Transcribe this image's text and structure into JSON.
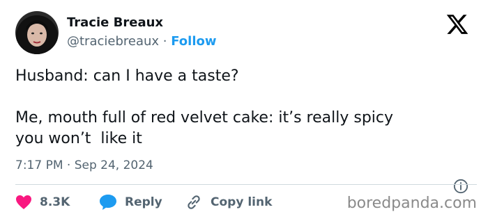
{
  "tweet": {
    "author_name": "Tracie Breaux",
    "handle": "@traciebreaux",
    "separator": " · ",
    "follow_label": "Follow",
    "text_lines": [
      "Husband: can I have a taste?",
      "",
      "Me, mouth full of red velvet cake: it’s really spicy",
      "you won’t  like it"
    ],
    "timestamp": "7:17 PM · Sep 24, 2024"
  },
  "actions": {
    "like_count": "8.3K",
    "reply_label": "Reply",
    "copy_link_label": "Copy link"
  },
  "watermark": "boredpanda.com",
  "icons": [
    "x-logo-icon",
    "info-icon",
    "heart-icon",
    "speech-bubble-icon",
    "link-icon"
  ],
  "colors": {
    "text": "#0f1419",
    "secondary": "#536471",
    "follow": "#1d9bf0",
    "like": "#f91880",
    "reply": "#1d9bf0",
    "divider": "#cfd9de"
  }
}
